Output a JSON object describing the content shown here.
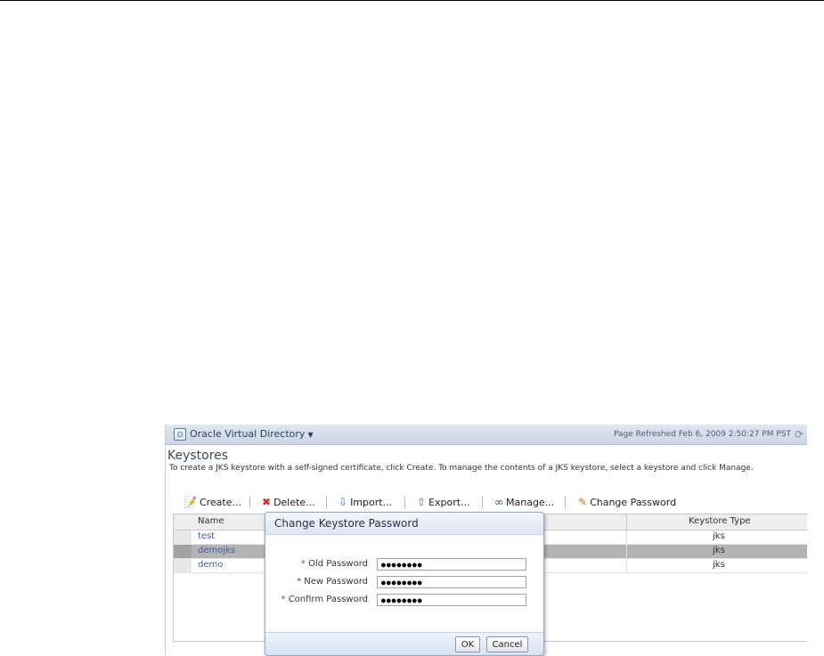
{
  "menubar": {
    "target_label": "Oracle Virtual Directory",
    "refreshed": "Page Refreshed Feb 6, 2009 2:50:27 PM PST"
  },
  "page": {
    "title": "Keystores",
    "instructions": "To create a JKS keystore with a self-signed certificate, click Create. To manage the contents of a JKS keystore, select a keystore and click Manage."
  },
  "toolbar": {
    "create": "Create...",
    "delete": "Delete...",
    "import": "Import...",
    "export": "Export...",
    "manage": "Manage...",
    "change_password": "Change Password"
  },
  "table": {
    "headers": {
      "name": "Name",
      "type": "Keystore Type"
    },
    "rows": [
      {
        "name": "test",
        "type": "jks",
        "selected": false
      },
      {
        "name": "demojks",
        "type": "jks",
        "selected": true
      },
      {
        "name": "demo",
        "type": "jks",
        "selected": false
      }
    ]
  },
  "dialog": {
    "title": "Change Keystore Password",
    "required_marker": "*",
    "fields": [
      {
        "label": "Old Password",
        "value": "●●●●●●●●"
      },
      {
        "label": "New Password",
        "value": "●●●●●●●●"
      },
      {
        "label": "Confirm Password",
        "value": "●●●●●●●●"
      }
    ],
    "ok_label": "OK",
    "cancel_label": "Cancel"
  },
  "colors": {
    "link": "#3d5e9c",
    "selected_row": "#b4b4b4",
    "header_band": "#dfe6f1"
  }
}
